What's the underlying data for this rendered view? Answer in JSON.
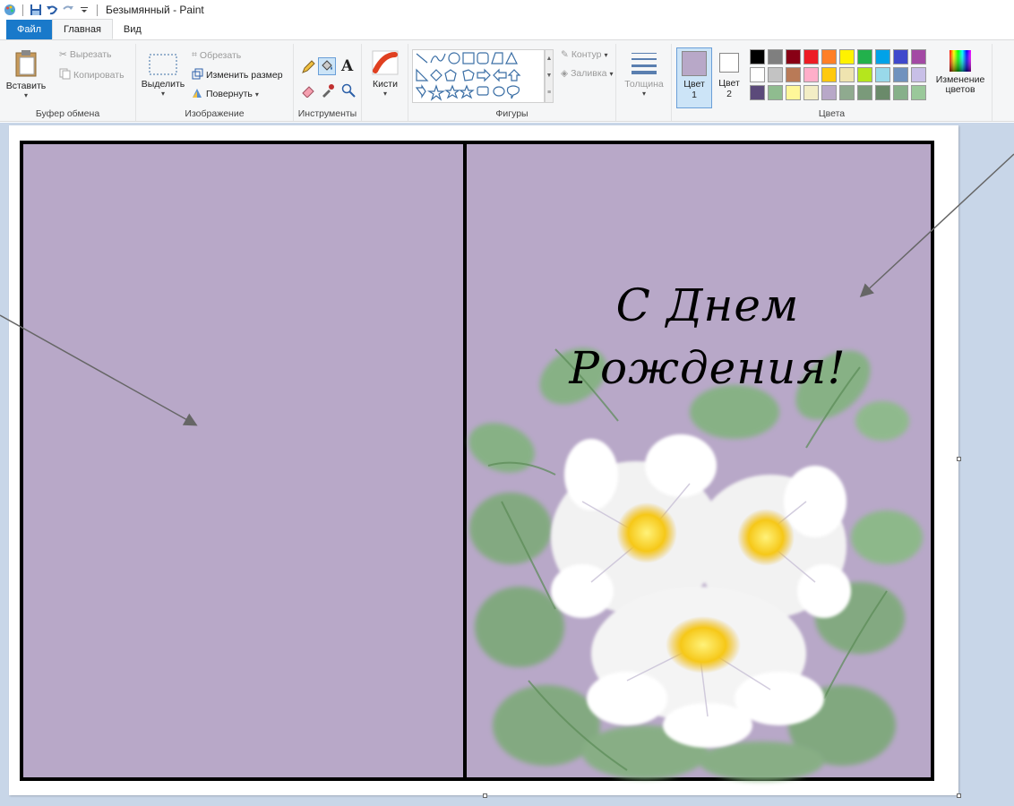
{
  "window": {
    "title": "Безымянный - Paint"
  },
  "tabs": {
    "file": "Файл",
    "home": "Главная",
    "view": "Вид"
  },
  "clipboard": {
    "paste": "Вставить",
    "cut": "Вырезать",
    "copy": "Копировать",
    "label": "Буфер обмена"
  },
  "image": {
    "select": "Выделить",
    "crop": "Обрезать",
    "resize": "Изменить размер",
    "rotate": "Повернуть",
    "label": "Изображение"
  },
  "tools": {
    "label": "Инструменты",
    "text_tool": "A"
  },
  "brushes": {
    "label": "Кисти"
  },
  "shapes": {
    "outline": "Контур",
    "fill": "Заливка",
    "label": "Фигуры"
  },
  "thickness": {
    "label": "Толщина"
  },
  "colors": {
    "color1_label": "Цвет",
    "color1_num": "1",
    "color2_label": "Цвет",
    "color2_num": "2",
    "edit_label": "Изменение цветов",
    "label": "Цвета",
    "color1_value": "#b8a8c8",
    "color2_value": "#ffffff",
    "palette_row1": [
      "#000000",
      "#7f7f7f",
      "#880015",
      "#ed1c24",
      "#ff7f27",
      "#fff200",
      "#22b14c",
      "#00a2e8",
      "#3f48cc",
      "#a349a4"
    ],
    "palette_row2": [
      "#ffffff",
      "#c3c3c3",
      "#b97a57",
      "#ffaec9",
      "#ffc90e",
      "#efe4b0",
      "#b5e61d",
      "#99d9ea",
      "#7092be",
      "#c8bfe7"
    ],
    "palette_row3": [
      "#5b4a7a",
      "#8fbc8f",
      "#fff799",
      "#f3edc5",
      "#b8a8c8",
      "#8faa8f",
      "#7a9a7a",
      "#6a8a6a",
      "#86b08a",
      "#9ac89a"
    ]
  },
  "canvas": {
    "card_color": "#b8a8c8",
    "greeting_line1": "С Днем",
    "greeting_line2": "Рождения!"
  }
}
